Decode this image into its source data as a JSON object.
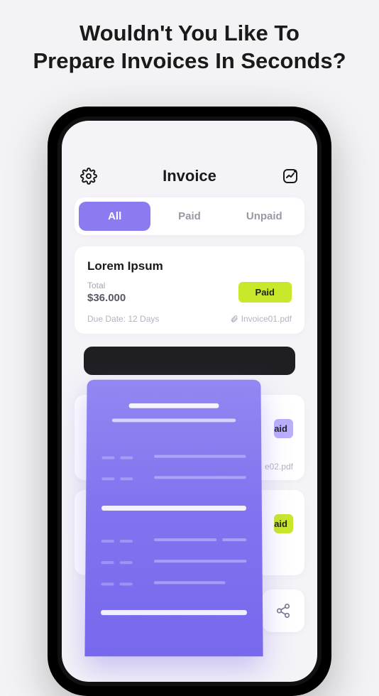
{
  "headline_l1": "Wouldn't You Like To",
  "headline_l2": "Prepare Invoices In Seconds?",
  "app": {
    "title": "Invoice",
    "tabs": {
      "all": "All",
      "paid": "Paid",
      "unpaid": "Unpaid"
    }
  },
  "card1": {
    "title": "Lorem Ipsum",
    "total_label": "Total",
    "total_value": "$36.000",
    "badge": "Paid",
    "due": "Due Date: 12 Days",
    "file": "Invoice01.pdf"
  },
  "hidden": {
    "badge1": "aid",
    "file1": "e02.pdf",
    "badge2": "aid"
  },
  "colors": {
    "accent": "#8a7cf0",
    "lime": "#c8e82b"
  }
}
